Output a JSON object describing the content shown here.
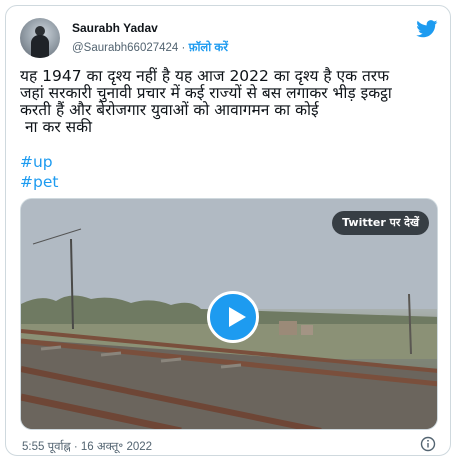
{
  "author": {
    "name": "Saurabh Yadav",
    "handle": "@Saurabh66027424",
    "separator": "·",
    "follow_label": "फ़ॉलो करें"
  },
  "tweet": {
    "text": "यह 1947 का दृश्य नहीं है यह आज 2022 का दृश्य है एक तरफ\nजहां सरकारी चुनावी प्रचार में कई राज्यों से बस लगाकर भीड़ इकट्ठा\nकरती हैं और बेरोजगार युवाओं को आवागमन का कोई\n ना कर सकी",
    "hashtags": [
      "#up",
      "#pet"
    ]
  },
  "media": {
    "watch_on_twitter_label": "Twitter पर देखें"
  },
  "footer": {
    "timestamp": "5:55 पूर्वाह्न · 16 अक्तू॰ 2022"
  },
  "colors": {
    "accent": "#1d9bf0",
    "text": "#0f1419",
    "muted": "#536471",
    "border": "#cfd9de"
  },
  "icons": {
    "brand": "twitter-bird-icon",
    "play": "play-icon",
    "info": "info-icon"
  }
}
